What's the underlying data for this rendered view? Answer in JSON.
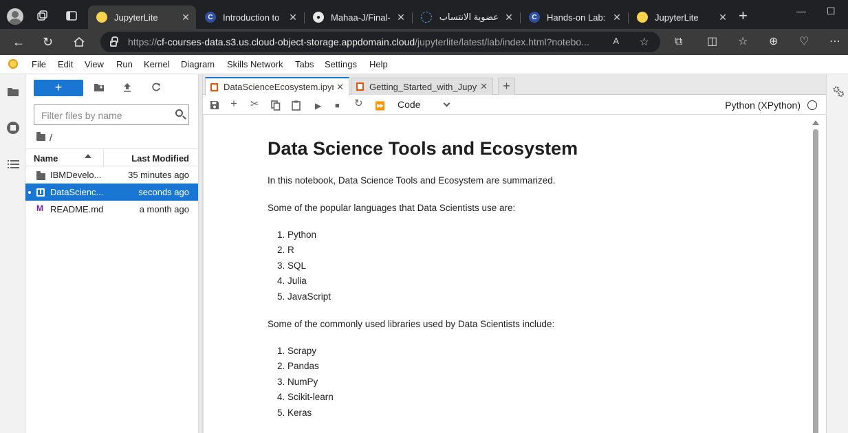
{
  "browser": {
    "tabs": [
      {
        "title": "JupyterLite",
        "favicon": "jupyterlite-icon",
        "active": true
      },
      {
        "title": "Introduction to D",
        "favicon": "coursera-icon",
        "active": false
      },
      {
        "title": "Mahaa-J/Final-A",
        "favicon": "github-icon",
        "active": false
      },
      {
        "title": "عضوية الانتساب (",
        "favicon": "arabic-site-icon",
        "active": false
      },
      {
        "title": "Hands-on Lab: U",
        "favicon": "coursera-icon",
        "active": false
      },
      {
        "title": "JupyterLite",
        "favicon": "jupyterlite-icon",
        "active": false
      }
    ],
    "url": {
      "scheme": "https://",
      "host": "cf-courses-data.s3.us.cloud-object-storage.appdomain.cloud",
      "path": "/jupyterlite/latest/lab/index.html?notebo..."
    },
    "colors": {
      "tabstrip": "#202124",
      "toolbar": "#3b3b3b"
    }
  },
  "menu": {
    "items": [
      "File",
      "Edit",
      "View",
      "Run",
      "Kernel",
      "Diagram",
      "Skills Network",
      "Tabs",
      "Settings",
      "Help"
    ]
  },
  "filebrowser": {
    "new_label": "+",
    "filter_placeholder": "Filter files by name",
    "breadcrumb": "/",
    "columns": {
      "name": "Name",
      "modified": "Last Modified"
    },
    "files": [
      {
        "name": "IBMDevelo...",
        "modified": "35 minutes ago",
        "type": "folder",
        "selected": false
      },
      {
        "name": "DataScienc...",
        "modified": "seconds ago",
        "type": "notebook",
        "selected": true
      },
      {
        "name": "README.md",
        "modified": "a month ago",
        "type": "markdown",
        "selected": false
      }
    ]
  },
  "doctabs": [
    {
      "title": "DataScienceEcosystem.ipynb",
      "active": true
    },
    {
      "title": "Getting_Started_with_Jupyter",
      "active": false
    }
  ],
  "toolbar": {
    "cell_type": "Code",
    "kernel": "Python (XPython)"
  },
  "notebook": {
    "title": "Data Science Tools and Ecosystem",
    "intro": "In this notebook, Data Science Tools and Ecosystem are summarized.",
    "languages_heading": "Some of the popular languages that Data Scientists use are:",
    "languages": [
      "1. Python",
      "2. R",
      "3. SQL",
      "4. Julia",
      "5. JavaScript"
    ],
    "libraries_heading": "Some of the commonly used libraries used by Data Scientists include:",
    "libraries": [
      "1. Scrapy",
      "2. Pandas",
      "3. NumPy",
      "4. Scikit-learn",
      "5. Keras"
    ]
  },
  "accent_color": "#1976d2"
}
